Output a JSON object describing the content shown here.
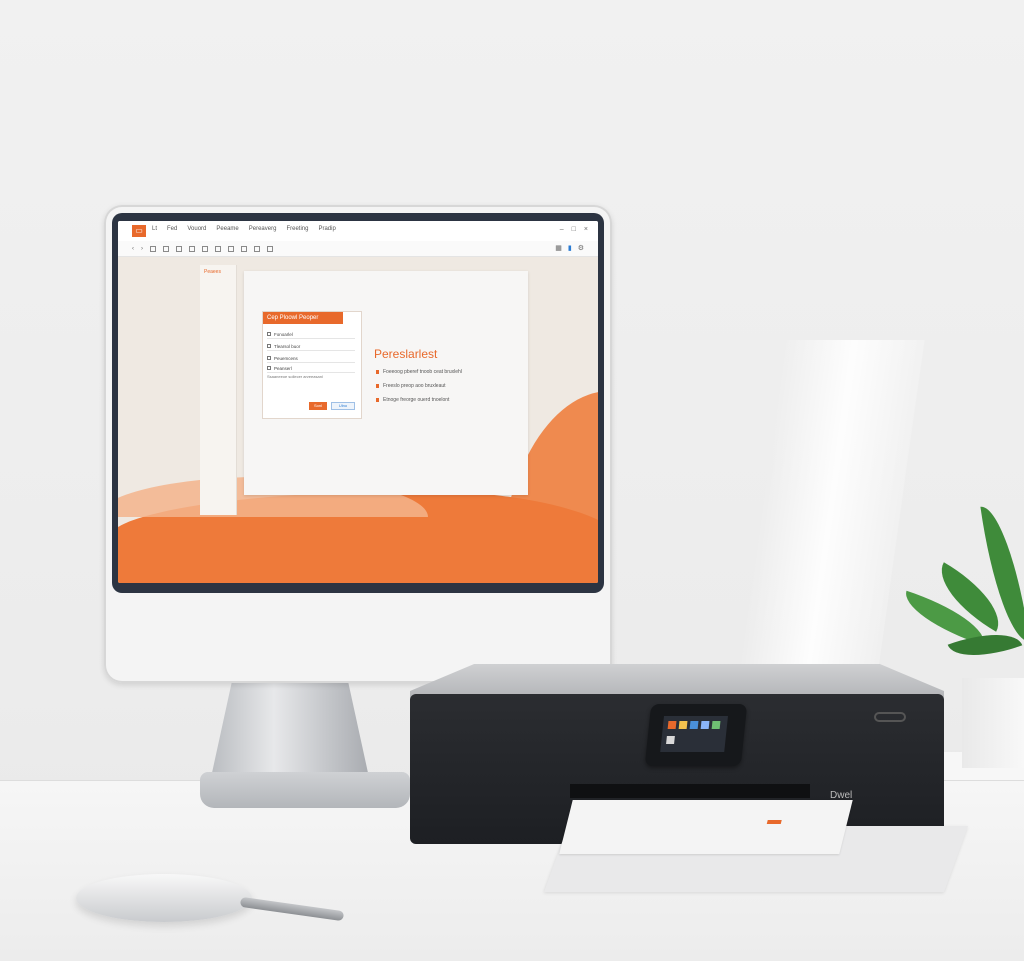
{
  "app": {
    "menu": [
      "Lt",
      "Fed",
      "Vouord",
      "Peeame",
      "Pereaverg",
      "Freeting",
      "Pradip"
    ],
    "doc_tab": "Peaees",
    "dialog": {
      "title": "Cep Ploowl Peoper",
      "rows": [
        "Fonoarlel",
        "Tlearsol buor",
        "Peuemcens",
        "Peanserl"
      ],
      "note": "Ssaaneeoe sollecer arveeasanl",
      "ok_label": "Sonl",
      "cancel_label": "Ulno"
    },
    "slide_title": "Pereslarlest",
    "bullets": [
      "Foeeoog pberef tnoob ceat bruxlehl",
      "Freeslo preop aoo bruxleaut",
      "Etnoge freorge ouerd tnoelont"
    ]
  },
  "printer": {
    "brand": "Dwel"
  },
  "colors": {
    "accent": "#e8692b",
    "blue": "#2a7bd3",
    "screen_bg": "#efe9e2"
  }
}
